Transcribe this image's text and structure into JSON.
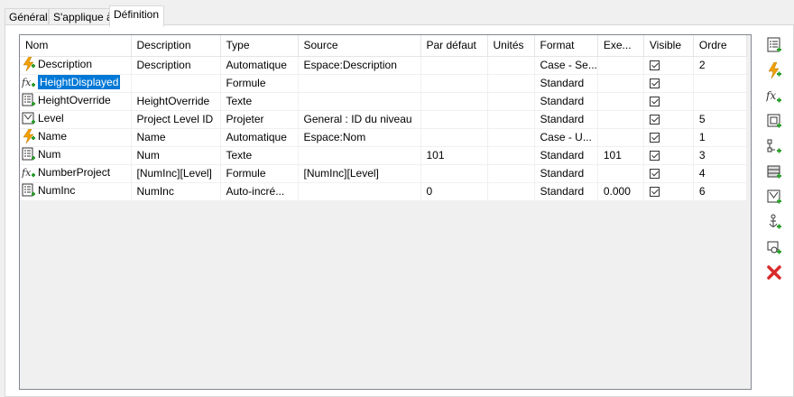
{
  "tabs": [
    {
      "label": "Général"
    },
    {
      "label": "S'applique à"
    },
    {
      "label": "Définition"
    }
  ],
  "columns": [
    "Nom",
    "Description",
    "Type",
    "Source",
    "Par défaut",
    "Unités",
    "Format",
    "Exe...",
    "Visible",
    "Ordre"
  ],
  "rows": [
    {
      "icon": "lightning-plus-icon",
      "name": "Description",
      "description": "Description",
      "type": "Automatique",
      "source": "Espace:Description",
      "default": "",
      "units": "",
      "format": "Case - Se...",
      "exe": "",
      "visible": true,
      "order": "2"
    },
    {
      "icon": "formula-plus-icon",
      "name": "HeightDisplayed",
      "description": "",
      "type": "Formule",
      "source": "",
      "default": "",
      "units": "",
      "format": "Standard",
      "exe": "",
      "visible": true,
      "order": "",
      "selected": true
    },
    {
      "icon": "list-plus-icon",
      "name": "HeightOverride",
      "description": "HeightOverride",
      "type": "Texte",
      "source": "",
      "default": "",
      "units": "",
      "format": "Standard",
      "exe": "",
      "visible": true,
      "order": ""
    },
    {
      "icon": "project-plus-icon",
      "name": "Level",
      "description": "Project Level ID",
      "type": "Projeter",
      "source": "General : ID du niveau",
      "default": "",
      "units": "",
      "format": "Standard",
      "exe": "",
      "visible": true,
      "order": "5"
    },
    {
      "icon": "lightning-plus-icon",
      "name": "Name",
      "description": "Name",
      "type": "Automatique",
      "source": "Espace:Nom",
      "default": "",
      "units": "",
      "format": "Case - U...",
      "exe": "",
      "visible": true,
      "order": "1"
    },
    {
      "icon": "list-plus-icon",
      "name": "Num",
      "description": "Num",
      "type": "Texte",
      "source": "",
      "default": "101",
      "units": "",
      "format": "Standard",
      "exe": "101",
      "visible": true,
      "order": "3"
    },
    {
      "icon": "formula-plus-icon",
      "name": "NumberProject",
      "description": "[NumInc][Level]",
      "type": "Formule",
      "source": "[NumInc][Level]",
      "default": "",
      "units": "",
      "format": "Standard",
      "exe": "",
      "visible": true,
      "order": "4"
    },
    {
      "icon": "list-plus-icon",
      "name": "NumInc",
      "description": "NumInc",
      "type": "Auto-incré...",
      "source": "",
      "default": "0",
      "units": "",
      "format": "Standard",
      "exe": "0.000",
      "visible": true,
      "order": "6"
    }
  ],
  "toolbar": [
    {
      "name": "add-text-property-icon"
    },
    {
      "name": "add-automatic-property-icon"
    },
    {
      "name": "add-formula-property-icon"
    },
    {
      "name": "add-graphic-property-icon"
    },
    {
      "name": "add-location-property-icon"
    },
    {
      "name": "add-classification-property-icon"
    },
    {
      "name": "add-project-property-icon"
    },
    {
      "name": "add-anchor-property-icon"
    },
    {
      "name": "add-reference-property-icon"
    },
    {
      "name": "delete-property-icon"
    }
  ],
  "colors": {
    "selection": "#0078d7",
    "accent_green": "#2a9d2a",
    "lightning": "#f0a000",
    "delete": "#d92b2b"
  }
}
